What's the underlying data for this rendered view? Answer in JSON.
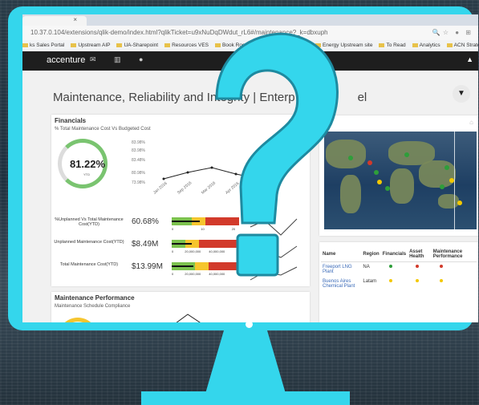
{
  "browser": {
    "tab_close": "×",
    "url": "10.37.0.104/extensions/qlik-demo/index.html?qlikTicket=u9xNuDqDWdut_rL6#/maintenance?_k=dbxuph",
    "bookmarks": [
      "ks Sales Portal",
      "Upstream AIP",
      "UA-Sharepoint",
      "Resources VES",
      "Book Room",
      "UK FY17 PA Roster",
      "Energy Upstream site",
      "To Read",
      "Analytics",
      "ACN Strategy"
    ]
  },
  "appbar": {
    "brand": "accenture",
    "icons": "✉ ▥ ●",
    "user_icon": "▲"
  },
  "page": {
    "title": "Maintenance, Reliability and Integrity | Enterp",
    "title_end": "el"
  },
  "financials": {
    "title": "Financials",
    "subtitle": "% Total Maintenance Cost Vs Budgeted Cost",
    "gauge_value": "81.22%",
    "gauge_label": "YTD",
    "kpis": [
      {
        "label": "%Unplanned Vs Total Maintenance Cost(YTD)",
        "value": "60.68%",
        "progress": 0.42
      },
      {
        "label": "Unplanned Maintenance Cost(YTD)",
        "value": "$8.49M",
        "progress": 0.3
      },
      {
        "label": "Total Maintenance Cost(YTD)",
        "value": "$13.99M",
        "progress": 0.32
      }
    ],
    "bullet_axis_1": [
      "0",
      "10",
      "20"
    ],
    "bullet_axis_2": [
      "0",
      "20,000,000",
      "40,000,000"
    ],
    "bullet_axis_3": [
      "0",
      "20,000,000",
      "40,000,000"
    ]
  },
  "chart_data": {
    "type": "line",
    "x": [
      "Jan 2016",
      "Sep 2016",
      "Mar 2016",
      "Apr 2016"
    ],
    "y_ticks": [
      "83.98%",
      "83.98%",
      "83.48%",
      "80.98%",
      "73.98%"
    ]
  },
  "maintenance": {
    "title": "Maintenance Performance",
    "subtitle": "Maintenance Schedule Compliance"
  },
  "table": {
    "headers": [
      "Name",
      "Region",
      "Financials",
      "Asset Health",
      "Maintenance Performance"
    ],
    "rows": [
      {
        "name": "Freeport LNG Plant",
        "region": "NA",
        "status": [
          "#2e9e3a",
          "#d23a2b",
          "#d23a2b"
        ]
      },
      {
        "name": "Buenos Aires Chemical Plant",
        "region": "Latam",
        "status": [
          "#f3c800",
          "#f3c800",
          "#f3c800"
        ]
      }
    ]
  },
  "colors": {
    "frame": "#34d6ec",
    "good": "#7cc24e",
    "warn": "#f6c52e",
    "bad": "#d23a2b"
  }
}
